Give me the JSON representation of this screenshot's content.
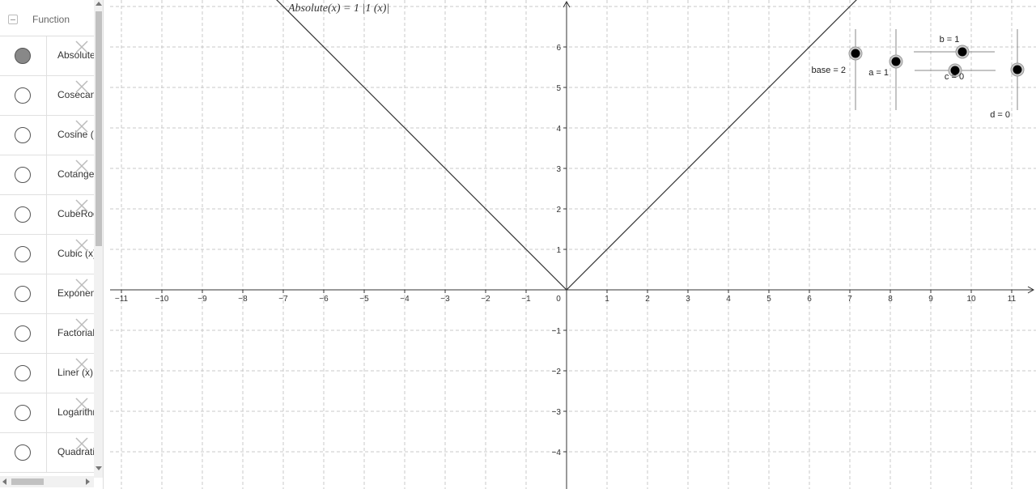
{
  "sidebar": {
    "title": "Function",
    "items": [
      {
        "label": "Absolute",
        "selected": true
      },
      {
        "label": "Cosecant",
        "selected": false
      },
      {
        "label": "Cosine (x)",
        "selected": false
      },
      {
        "label": "Cotangent",
        "selected": false
      },
      {
        "label": "CubeRoot",
        "selected": false
      },
      {
        "label": "Cubic (x)",
        "selected": false
      },
      {
        "label": "Exponential",
        "selected": false
      },
      {
        "label": "Factorial",
        "selected": false
      },
      {
        "label": "Liner (x)",
        "selected": false
      },
      {
        "label": "Logarithm",
        "selected": false
      },
      {
        "label": "Quadratic",
        "selected": false
      }
    ]
  },
  "graph": {
    "function_label": "Absolute(x) = 1 |1 (x)|",
    "x_ticks": [
      "−11",
      "−10",
      "−9",
      "−8",
      "−7",
      "−6",
      "−5",
      "−4",
      "−3",
      "−2",
      "−1",
      "1",
      "2",
      "3",
      "4",
      "5",
      "6",
      "7",
      "8",
      "9",
      "10",
      "11"
    ],
    "origin_label": "0",
    "y_ticks_pos": [
      "1",
      "2",
      "3",
      "4",
      "5",
      "6"
    ],
    "y_ticks_neg": [
      "−1",
      "−2",
      "−3",
      "−4"
    ],
    "sliders": {
      "base": "base = 2",
      "a": "a = 1",
      "b": "b = 1",
      "c": "c = 0",
      "d": "d = 0"
    }
  }
}
